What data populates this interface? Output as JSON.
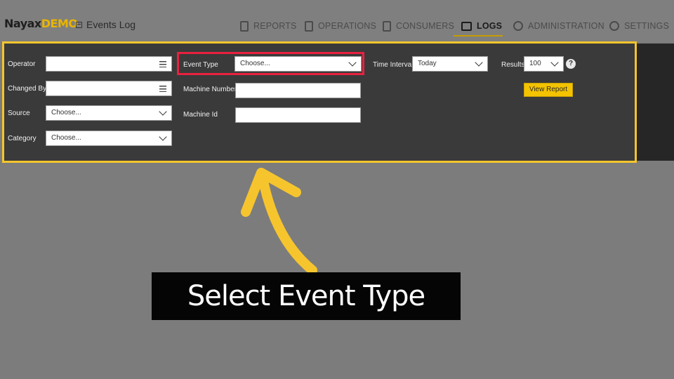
{
  "header": {
    "brand": "Nayax",
    "brand_suffix": "DEMO",
    "page_title": "Events Log",
    "nav": [
      {
        "label": "REPORTS",
        "icon": "report-icon"
      },
      {
        "label": "OPERATIONS",
        "icon": "device-icon"
      },
      {
        "label": "CONSUMERS",
        "icon": "consumer-icon"
      },
      {
        "label": "LOGS",
        "icon": "calendar-icon",
        "active": true
      },
      {
        "label": "ADMINISTRATION",
        "icon": "badge-icon"
      },
      {
        "label": "SETTINGS",
        "icon": "gear-icon"
      }
    ]
  },
  "filters": {
    "operator": {
      "label": "Operator",
      "value": ""
    },
    "changed_by": {
      "label": "Changed By",
      "value": ""
    },
    "source": {
      "label": "Source",
      "value": "Choose..."
    },
    "category": {
      "label": "Category",
      "value": "Choose..."
    },
    "event_type": {
      "label": "Event Type",
      "value": "Choose..."
    },
    "machine_number": {
      "label": "Machine Number",
      "value": ""
    },
    "machine_id": {
      "label": "Machine Id",
      "value": ""
    },
    "time_interval": {
      "label": "Time Interval",
      "value": "Today"
    },
    "results": {
      "label": "Results",
      "value": "100"
    },
    "help": "?",
    "view_report": "View Report"
  },
  "annotation": {
    "caption": "Select Event Type",
    "highlight_color": "#e8213f",
    "arrow_color": "#f6c52d"
  }
}
